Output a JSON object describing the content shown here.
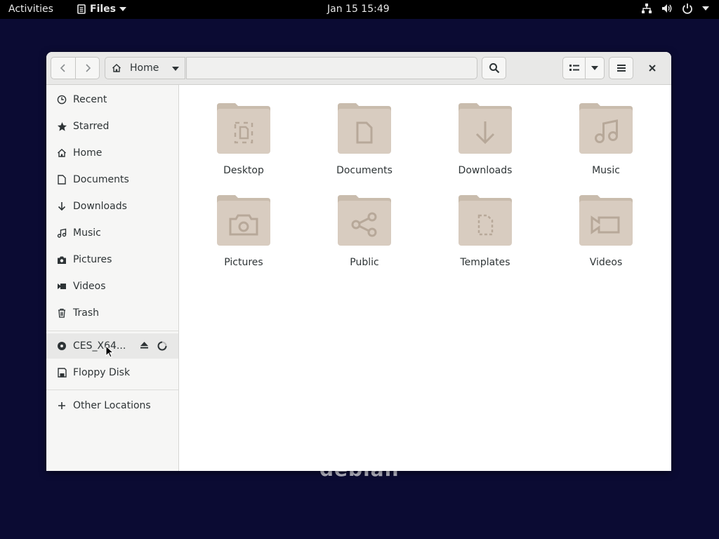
{
  "topbar": {
    "activities": "Activities",
    "app_name": "Files",
    "clock": "Jan 15  15:49",
    "tray_icons": [
      "network-icon",
      "volume-icon",
      "power-icon"
    ]
  },
  "headerbar": {
    "path_segment": "Home"
  },
  "sidebar": {
    "items": [
      {
        "label": "Recent",
        "icon": "clock-icon"
      },
      {
        "label": "Starred",
        "icon": "star-icon"
      },
      {
        "label": "Home",
        "icon": "home-icon"
      },
      {
        "label": "Documents",
        "icon": "document-icon"
      },
      {
        "label": "Downloads",
        "icon": "download-icon"
      },
      {
        "label": "Music",
        "icon": "music-icon"
      },
      {
        "label": "Pictures",
        "icon": "camera-icon"
      },
      {
        "label": "Videos",
        "icon": "video-icon"
      },
      {
        "label": "Trash",
        "icon": "trash-icon"
      }
    ],
    "devices": [
      {
        "label": "CES_X64...",
        "icon": "disc-icon"
      },
      {
        "label": "Floppy Disk",
        "icon": "floppy-icon"
      }
    ],
    "other_locations": "Other Locations"
  },
  "folders": [
    {
      "label": "Desktop",
      "emblem": "desktop"
    },
    {
      "label": "Documents",
      "emblem": "document"
    },
    {
      "label": "Downloads",
      "emblem": "download"
    },
    {
      "label": "Music",
      "emblem": "music"
    },
    {
      "label": "Pictures",
      "emblem": "camera"
    },
    {
      "label": "Public",
      "emblem": "share"
    },
    {
      "label": "Templates",
      "emblem": "template"
    },
    {
      "label": "Videos",
      "emblem": "video"
    }
  ],
  "background_logo": "debian",
  "colors": {
    "desktop_bg": "#0b0b33",
    "folder": "#d8ccc0",
    "folder_tab": "#c9bcad",
    "emblem": "#b7a899"
  }
}
